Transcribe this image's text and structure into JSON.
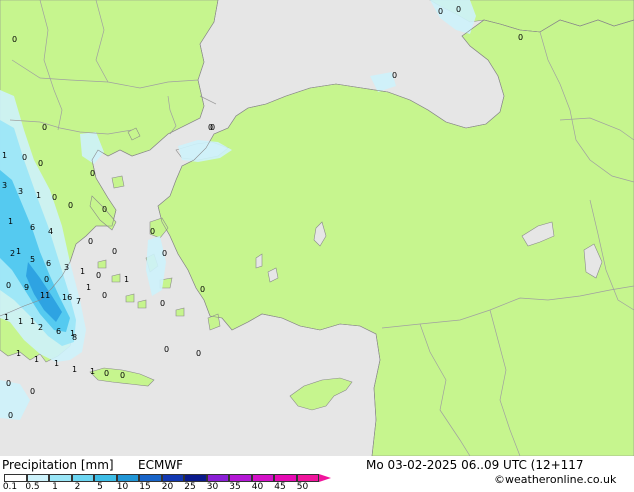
{
  "header": {
    "product_label": "Precipitation [mm]",
    "model_label": "ECMWF",
    "datetime_label": "Mo 03-02-2025 06..09 UTC (12+117",
    "credit_label": "©weatheronline.co.uk"
  },
  "legend": {
    "ticks": [
      "0.1",
      "0.5",
      "1",
      "2",
      "5",
      "10",
      "15",
      "20",
      "25",
      "30",
      "35",
      "40",
      "45",
      "50"
    ],
    "colors": [
      "#ffffff",
      "#cdf2fb",
      "#9ae6f7",
      "#6cd6f2",
      "#3dbde6",
      "#2196d6",
      "#1864c8",
      "#1238b2",
      "#0a1a8c",
      "#8a1fd6",
      "#b418d6",
      "#d412c8",
      "#e60ab4",
      "#f0149c"
    ]
  },
  "map": {
    "colors": {
      "sea": "#e6e6e6",
      "land": "#c6f58e",
      "border": "#a0a0a0",
      "coast": "#8a8a8a",
      "rain_light": "#cdf2fb",
      "rain_mid": "#9ae6f7",
      "rain_high": "#4cc6ee",
      "rain_peak": "#2a9ee0"
    },
    "precip_values": [
      "0",
      "0",
      "0",
      "0",
      "1",
      "0",
      "0",
      "0",
      "3",
      "3",
      "0",
      "1",
      "0",
      "0",
      "1",
      "6",
      "4",
      "1",
      "0",
      "0",
      "2",
      "5",
      "6",
      "3",
      "1",
      "0",
      "0",
      "1",
      "0",
      "0",
      "9",
      "11",
      "16",
      "7",
      "1",
      "1",
      "1",
      "1",
      "2",
      "6",
      "1",
      "8",
      "1",
      "1",
      "1",
      "1",
      "1",
      "0",
      "0",
      "0",
      "0",
      "0",
      "0",
      "0",
      "0",
      "0",
      "0",
      "0",
      "0",
      "0",
      "0",
      "0"
    ]
  }
}
